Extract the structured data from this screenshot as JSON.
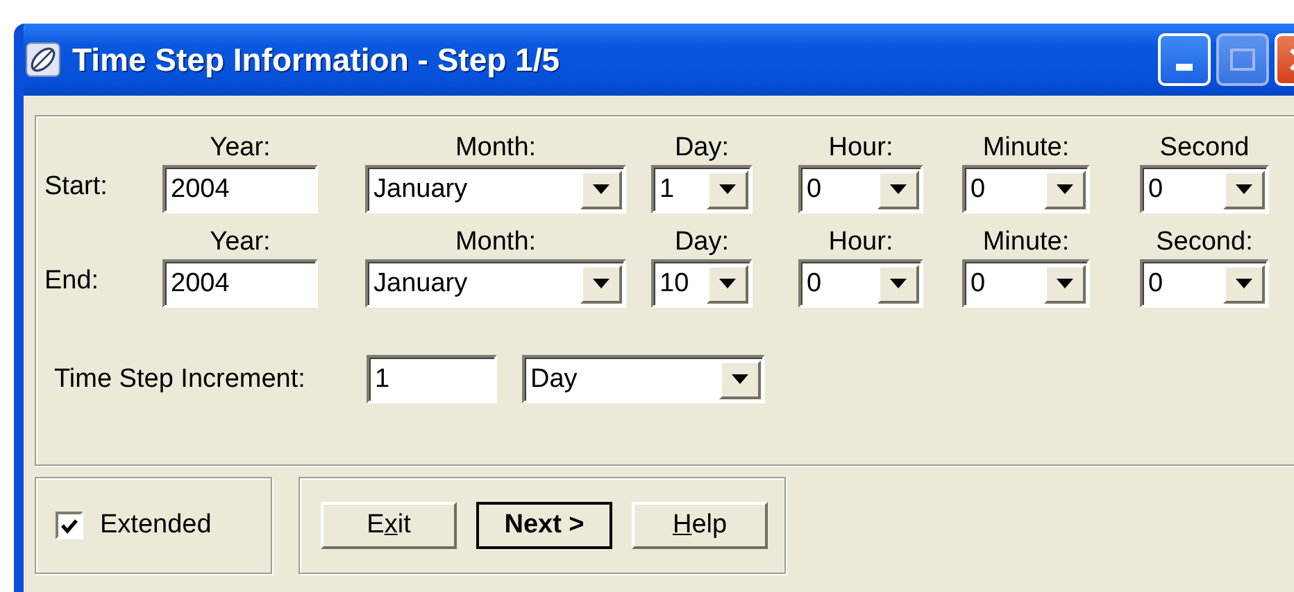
{
  "window": {
    "title": "Time Step Information - Step 1/5"
  },
  "rows": [
    {
      "label": "Start:",
      "fields": [
        {
          "header": "Year:",
          "kind": "text",
          "value": "2004"
        },
        {
          "header": "Month:",
          "kind": "dropdown",
          "value": "January"
        },
        {
          "header": "Day:",
          "kind": "dropdown",
          "value": "1"
        },
        {
          "header": "Hour:",
          "kind": "dropdown",
          "value": "0"
        },
        {
          "header": "Minute:",
          "kind": "dropdown",
          "value": "0"
        },
        {
          "header": "Second",
          "kind": "dropdown",
          "value": "0"
        }
      ]
    },
    {
      "label": "End:",
      "fields": [
        {
          "header": "Year:",
          "kind": "text",
          "value": "2004"
        },
        {
          "header": "Month:",
          "kind": "dropdown",
          "value": "January"
        },
        {
          "header": "Day:",
          "kind": "dropdown",
          "value": "10"
        },
        {
          "header": "Hour:",
          "kind": "dropdown",
          "value": "0"
        },
        {
          "header": "Minute:",
          "kind": "dropdown",
          "value": "0"
        },
        {
          "header": "Second:",
          "kind": "dropdown",
          "value": "0"
        }
      ]
    }
  ],
  "increment": {
    "label": "Time Step Increment:",
    "value": "1",
    "unit": "Day"
  },
  "extended": {
    "label": "Extended",
    "checked": true
  },
  "buttons": [
    {
      "before": "E",
      "key": "x",
      "after": "it",
      "default": false
    },
    {
      "before": "Next >",
      "default": true
    },
    {
      "key": "H",
      "after": "elp",
      "default": false
    }
  ]
}
